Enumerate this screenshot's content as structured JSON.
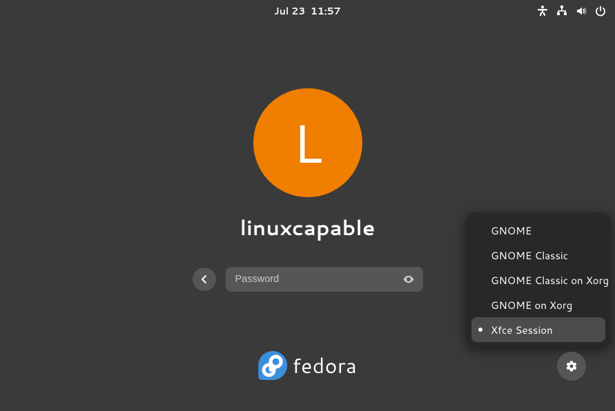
{
  "topbar": {
    "date": "Jul 23",
    "time": "11:57"
  },
  "tray_icons": [
    "accessibility",
    "network",
    "volume",
    "power"
  ],
  "user": {
    "initial": "L",
    "name": "linuxcapable"
  },
  "password": {
    "placeholder": "Password",
    "value": ""
  },
  "distro": {
    "name": "fedora",
    "accent": "#3c8fdd"
  },
  "avatar_color": "#f07e00",
  "session_menu": {
    "items": [
      {
        "label": "GNOME",
        "selected": false
      },
      {
        "label": "GNOME Classic",
        "selected": false
      },
      {
        "label": "GNOME Classic on Xorg",
        "selected": false
      },
      {
        "label": "GNOME on Xorg",
        "selected": false
      },
      {
        "label": "Xfce Session",
        "selected": true
      }
    ]
  }
}
